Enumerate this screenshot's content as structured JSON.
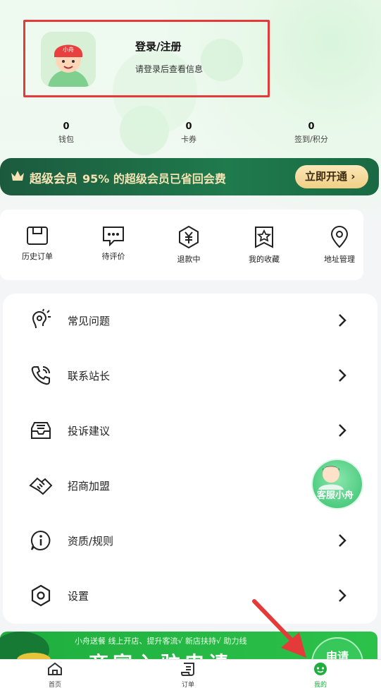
{
  "profile": {
    "title": "登录/注册",
    "subtitle": "请登录后查看信息",
    "avatar_badge": "小舟"
  },
  "stats": [
    {
      "value": "0",
      "label": "钱包"
    },
    {
      "value": "0",
      "label": "卡券"
    },
    {
      "value": "0",
      "label": "签到/积分"
    }
  ],
  "vip": {
    "title": "超级会员",
    "text": "95% 的超级会员已省回会费",
    "button": "立即开通 ›"
  },
  "quick_actions": [
    {
      "label": "历史订单",
      "icon": "history-order-icon"
    },
    {
      "label": "待评价",
      "icon": "comment-icon"
    },
    {
      "label": "退款中",
      "icon": "refund-icon"
    },
    {
      "label": "我的收藏",
      "icon": "favorite-icon"
    },
    {
      "label": "地址管理",
      "icon": "location-icon"
    }
  ],
  "menu": [
    {
      "label": "常见问题",
      "icon": "faq-icon"
    },
    {
      "label": "联系站长",
      "icon": "phone-icon"
    },
    {
      "label": "投诉建议",
      "icon": "inbox-icon"
    },
    {
      "label": "招商加盟",
      "icon": "handshake-icon"
    },
    {
      "label": "资质/规则",
      "icon": "info-icon"
    },
    {
      "label": "设置",
      "icon": "settings-icon"
    }
  ],
  "service": {
    "label": "客服小舟"
  },
  "banner": {
    "text": "小舟送餐 线上开店、提升客流√ 新店扶持√ 助力线",
    "big": "商家入驻申请",
    "button": "申请"
  },
  "tabs": [
    {
      "label": "首页",
      "icon": "home-icon"
    },
    {
      "label": "订单",
      "icon": "order-icon"
    },
    {
      "label": "我的",
      "icon": "mine-icon",
      "active": true
    }
  ],
  "colors": {
    "accent": "#1fae3f",
    "vip_bg": "#1c5a3e",
    "vip_gold": "#f6e3b4",
    "highlight_red": "#e53a3a"
  }
}
